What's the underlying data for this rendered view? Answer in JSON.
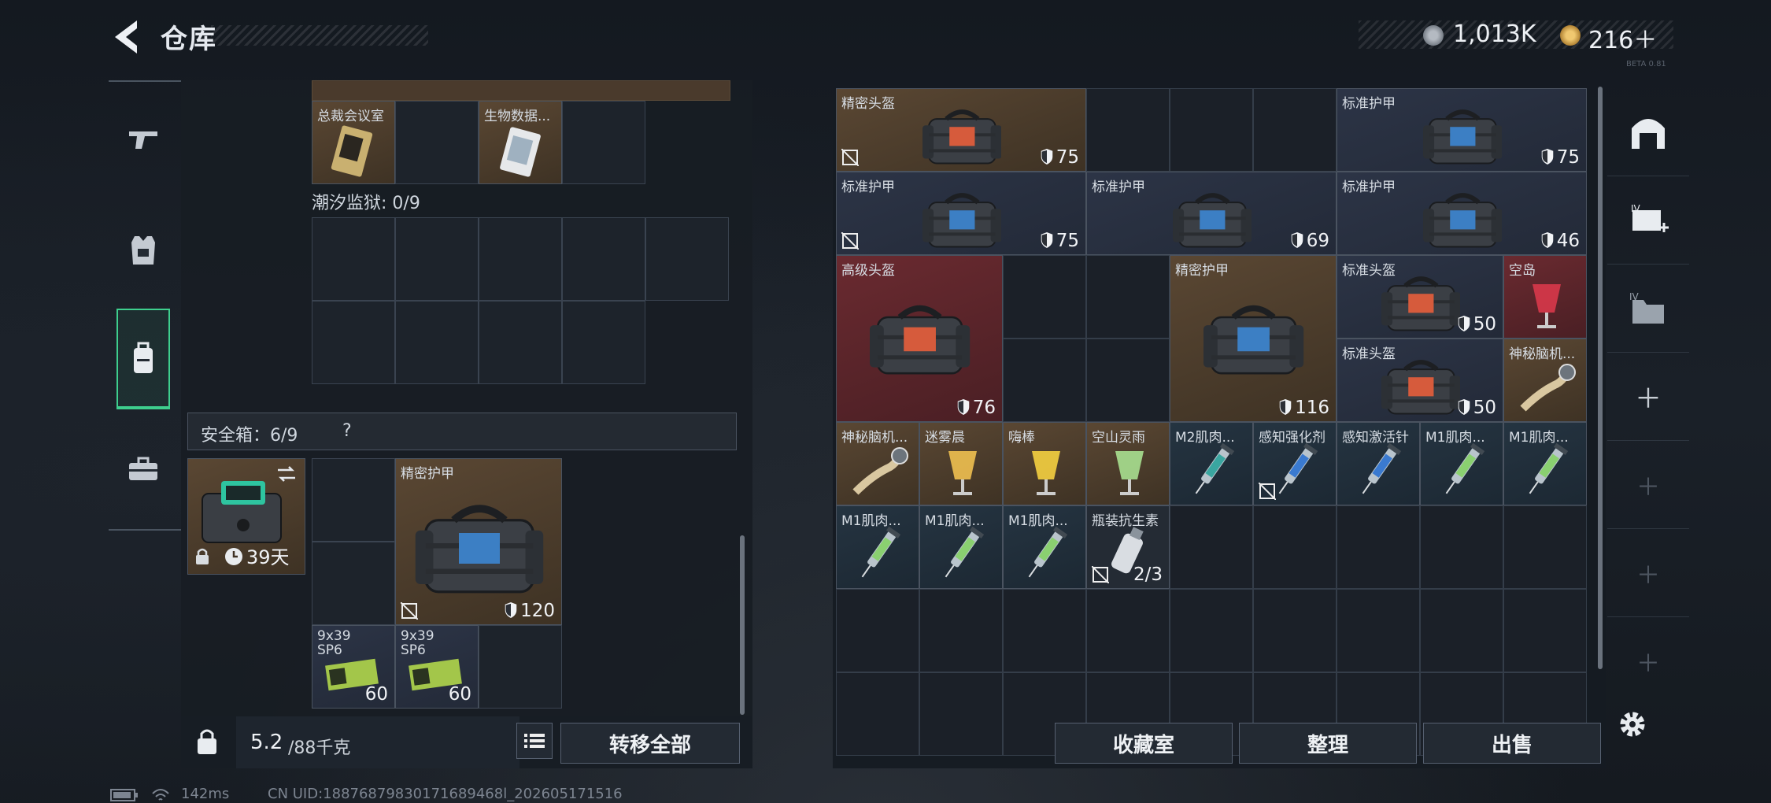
{
  "header": {
    "title": "仓库",
    "currency1": "1,013K",
    "currency2": "216＋",
    "version": "BETA 0.81"
  },
  "left_nav": [
    "gun-icon",
    "armor-vest-icon",
    "backpack-icon",
    "briefcase-icon"
  ],
  "top_items": {
    "item1_name": "总裁会议室",
    "item2_name": "生物数据..."
  },
  "tide_prison": {
    "label": "潮汐监狱: 0/9"
  },
  "safe_box": {
    "label": "安全箱：6/9",
    "help": "?",
    "days": "39天",
    "armor_name": "精密护甲",
    "armor_value": "120",
    "ammo1_name": "9x39\nSP6",
    "ammo1_count": "60",
    "ammo2_name": "9x39\nSP6",
    "ammo2_count": "60"
  },
  "weight": {
    "current": "5.2",
    "total": "/88千克"
  },
  "left_buttons": {
    "transfer_all": "转移全部"
  },
  "right_items": [
    {
      "name": "精密头盔",
      "value": "75"
    },
    {
      "name": "标准护甲",
      "value": "75"
    },
    {
      "name": "标准护甲",
      "value": "75"
    },
    {
      "name": "标准护甲",
      "value": "69"
    },
    {
      "name": "标准护甲",
      "value": "46"
    },
    {
      "name": "高级头盔",
      "value": "76"
    },
    {
      "name": "精密护甲",
      "value": "116"
    },
    {
      "name": "标准头盔",
      "value": "50"
    },
    {
      "name": "空岛",
      "value": ""
    },
    {
      "name": "标准头盔",
      "value": "50"
    },
    {
      "name": "神秘脑机...",
      "value": ""
    },
    {
      "name": "神秘脑机...",
      "value": ""
    },
    {
      "name": "迷雾晨",
      "value": ""
    },
    {
      "name": "嗨棒",
      "value": ""
    },
    {
      "name": "空山灵雨",
      "value": ""
    },
    {
      "name": "M2肌肉...",
      "value": ""
    },
    {
      "name": "感知强化剂",
      "value": ""
    },
    {
      "name": "感知激活针",
      "value": ""
    },
    {
      "name": "M1肌肉...",
      "value": ""
    },
    {
      "name": "M1肌肉...",
      "value": ""
    },
    {
      "name": "M1肌肉...",
      "value": ""
    },
    {
      "name": "M1肌肉...",
      "value": ""
    },
    {
      "name": "M1肌肉...",
      "value": ""
    },
    {
      "name": "瓶装抗生素",
      "value": "2/3"
    }
  ],
  "right_buttons": {
    "collection": "收藏室",
    "sort": "整理",
    "sell": "出售"
  },
  "status_bar": {
    "ping": "142ms",
    "uid": "CN UID:18876879830171689468l_202605171516"
  },
  "colors": {
    "accent_green": "#3ecf8e",
    "item_gold": "#5a4733",
    "item_navy": "#2c3446",
    "item_red": "#6a2a30"
  }
}
